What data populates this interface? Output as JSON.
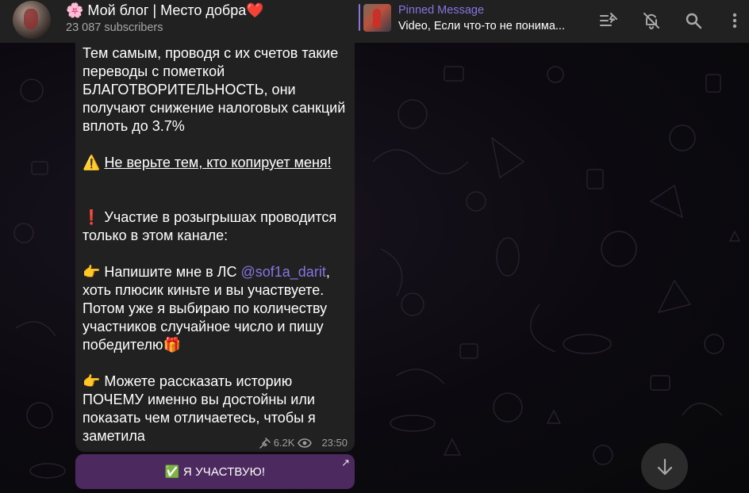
{
  "header": {
    "channel_title": "🌸 Мой блог | Место добра❤️",
    "subscribers": "23 087 subscribers",
    "pinned": {
      "label": "Pinned Message",
      "text": "Video, Если что-то не понима..."
    },
    "icons": [
      "pinned-list-icon",
      "mute-bell-icon",
      "search-icon",
      "more-vertical-icon"
    ]
  },
  "message": {
    "lines": {
      "p1": "Тем самым, проводя с их счетов такие переводы с пометкой БЛАГОТВОРИТЕЛЬНОСТЬ, они получают снижение налоговых санкций вплоть до 3.7%",
      "warn_emoji": "⚠️",
      "warn_text": "Не верьте тем, кто копирует меня!",
      "p2": "❗  Участие в розыгрышах проводится только в этом канале:",
      "p3_prefix": "👉  Напишите мне в ЛС ",
      "p3_mention": "@sof1a_darit",
      "p3_suffix": ", хоть плюсик киньте и вы участвуете. Потом уже я выбираю по количеству участников случайное число и пишу победителю🎁",
      "p4": "👉  Можете рассказать историю ПОЧЕМУ именно вы достойны или показать чем отличаетесь, чтобы я заметила"
    },
    "meta": {
      "views": "6.2K",
      "time": "23:50"
    },
    "button": {
      "label": "✅  Я УЧАСТВУЮ!",
      "arrow": "↗"
    }
  },
  "colors": {
    "accent": "#8774e1",
    "header_bg": "#212121",
    "bubble_bg": "#212121",
    "button_bg": "#4c2a5f"
  }
}
